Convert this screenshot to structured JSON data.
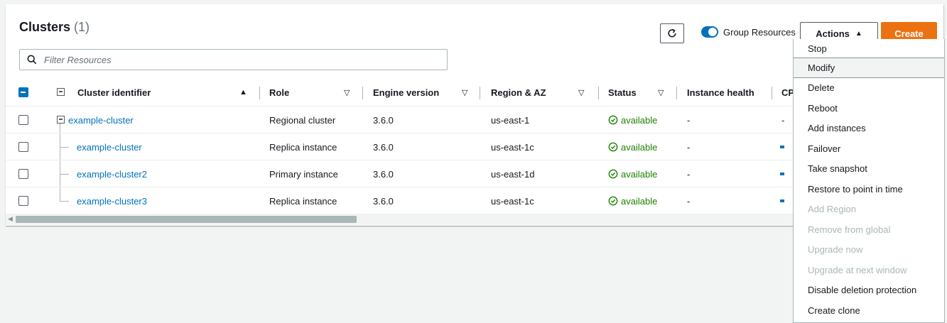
{
  "panel": {
    "title": "Clusters",
    "count": "(1)"
  },
  "filter": {
    "placeholder": "Filter Resources",
    "value": ""
  },
  "toolbar": {
    "group_resources_label": "Group Resources",
    "actions_label": "Actions",
    "create_label": "Create",
    "group_resources_on": true
  },
  "table": {
    "columns": [
      {
        "label": "Cluster identifier",
        "sort": "▲"
      },
      {
        "label": "Role",
        "sort": "▽"
      },
      {
        "label": "Engine version",
        "sort": "▽"
      },
      {
        "label": "Region & AZ",
        "sort": "▽"
      },
      {
        "label": "Status",
        "sort": "▽"
      },
      {
        "label": "Instance health"
      },
      {
        "label": "CP"
      }
    ],
    "rows": [
      {
        "id": "example-cluster",
        "role": "Regional cluster",
        "engine": "3.6.0",
        "region": "us-east-1",
        "status": "available",
        "health": "-",
        "cpu": "-"
      },
      {
        "id": "example-cluster",
        "role": "Replica instance",
        "engine": "3.6.0",
        "region": "us-east-1c",
        "status": "available",
        "health": "-"
      },
      {
        "id": "example-cluster2",
        "role": "Primary instance",
        "engine": "3.6.0",
        "region": "us-east-1d",
        "status": "available",
        "health": "-"
      },
      {
        "id": "example-cluster3",
        "role": "Replica instance",
        "engine": "3.6.0",
        "region": "us-east-1c",
        "status": "available",
        "health": "-"
      }
    ]
  },
  "actions_menu": [
    {
      "label": "Stop",
      "disabled": false
    },
    {
      "label": "Modify",
      "disabled": false,
      "highlighted": true
    },
    {
      "label": "Delete",
      "disabled": false
    },
    {
      "label": "Reboot",
      "disabled": false
    },
    {
      "label": "Add instances",
      "disabled": false
    },
    {
      "label": "Failover",
      "disabled": false
    },
    {
      "label": "Take snapshot",
      "disabled": false
    },
    {
      "label": "Restore to point in time",
      "disabled": false
    },
    {
      "label": "Add Region",
      "disabled": true
    },
    {
      "label": "Remove from global",
      "disabled": true
    },
    {
      "label": "Upgrade now",
      "disabled": true
    },
    {
      "label": "Upgrade at next window",
      "disabled": true
    },
    {
      "label": "Disable deletion protection",
      "disabled": false
    },
    {
      "label": "Create clone",
      "disabled": false
    }
  ],
  "colors": {
    "accent": "#0073bb",
    "create_button": "#ec7211",
    "status_ok": "#1d8102",
    "disabled_text": "#aab7b8"
  },
  "icons": {
    "search": "search-icon",
    "refresh": "refresh-icon",
    "status": "check-circle-icon",
    "expand": "collapse-icon",
    "actions_caret": "caret-up-icon"
  }
}
